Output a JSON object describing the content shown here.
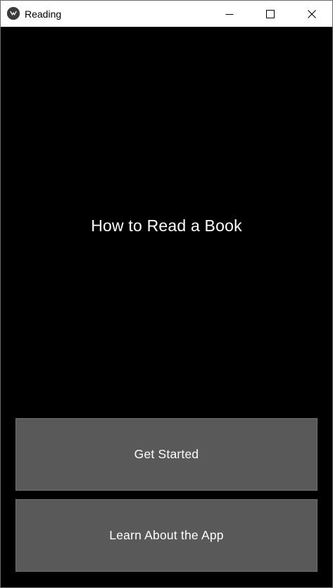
{
  "window": {
    "title": "Reading",
    "icon": "kivy-app-icon",
    "controls": [
      "minimize-icon",
      "maximize-icon",
      "close-icon"
    ]
  },
  "main": {
    "heading": "How to Read a Book",
    "buttons": {
      "get_started": "Get Started",
      "learn_about": "Learn About the App"
    }
  },
  "colors": {
    "background": "#000000",
    "button": "#595959",
    "text": "#ffffff",
    "titlebar": "#ffffff"
  }
}
